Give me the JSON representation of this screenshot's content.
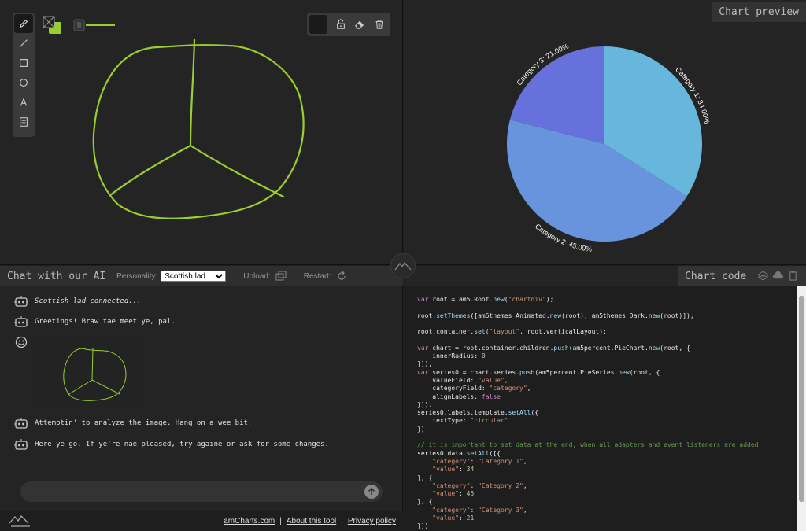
{
  "preview": {
    "title": "Chart preview"
  },
  "chart_data": {
    "type": "pie",
    "categories": [
      "Category 1",
      "Category 2",
      "Category 3"
    ],
    "values": [
      34,
      45,
      21
    ],
    "labels": [
      "Category 1: 34.00%",
      "Category 2: 45.00%",
      "Category 3: 21.00%"
    ],
    "colors": [
      "#67b7dc",
      "#6794dc",
      "#6771dc"
    ]
  },
  "chat": {
    "title": "Chat with our AI",
    "personality_label": "Personality:",
    "personality_value": "Scottish lad",
    "upload_label": "Upload:",
    "restart_label": "Restart:",
    "messages": [
      "Scottish lad connected...",
      "Greetings! Braw tae meet ye, pal.",
      "Attemptin' to analyze the image. Hang on a wee bit.",
      "Here ye go. If ye're nae pleased, try againe or ask for some changes."
    ],
    "footer": {
      "link1": "amCharts.com",
      "link2": "About this tool",
      "link3": "Privacy policy"
    }
  },
  "code": {
    "title": "Chart code",
    "source": "var root = am5.Root.new(\"chartdiv\");\n\nroot.setThemes([am5themes_Animated.new(root), am5themes_Dark.new(root)]);\n\nroot.container.set(\"layout\", root.verticalLayout);\n\nvar chart = root.container.children.push(am5percent.PieChart.new(root, {\n    innerRadius: 0\n}));\nvar series0 = chart.series.push(am5percent.PieSeries.new(root, {\n    valueField: \"value\",\n    categoryField: \"category\",\n    alignLabels: false\n}));\nseries0.labels.template.setAll({\n    textType: \"circular\"\n})\n\n// it is important to set data at the end, when all adapters and event listeners are added\nseries0.data.setAll([{\n    \"category\": \"Category 1\",\n    \"value\": 34\n}, {\n    \"category\": \"Category 2\",\n    \"value\": 45\n}, {\n    \"category\": \"Category 3\",\n    \"value\": 21\n}])"
  },
  "icons": {
    "tools": [
      "pencil-icon",
      "line-icon",
      "rectangle-icon",
      "circle-icon",
      "text-icon",
      "note-icon"
    ],
    "topbar": [
      "unlock-icon",
      "eraser-icon",
      "trash-icon"
    ]
  },
  "colors": {
    "stroke": "#9acd32",
    "accent": "#67b7dc"
  }
}
